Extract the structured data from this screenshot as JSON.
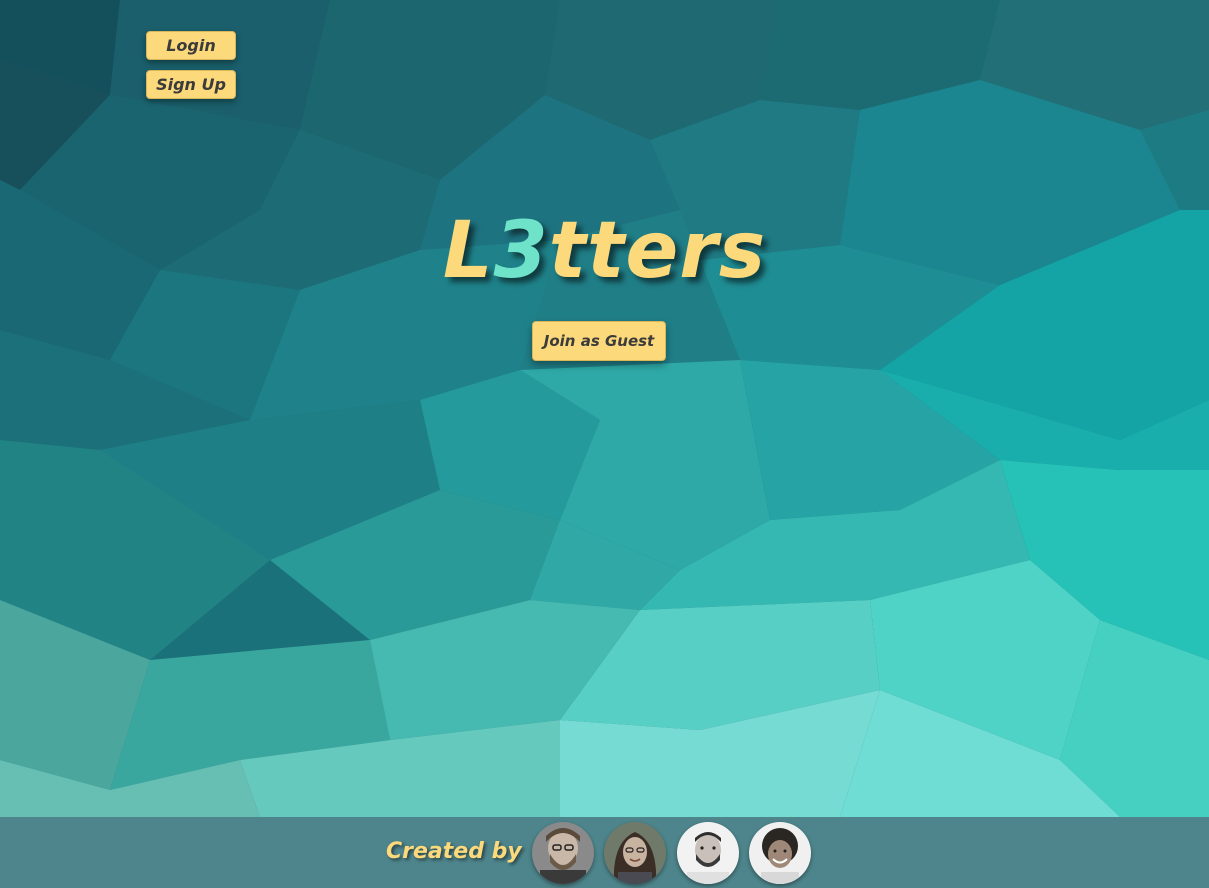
{
  "auth": {
    "login_label": "Login",
    "signup_label": "Sign Up"
  },
  "logo": {
    "part1": "L",
    "accent": "3",
    "part2": "tters"
  },
  "main": {
    "guest_label": "Join as Guest"
  },
  "footer": {
    "created_by_label": "Created by"
  },
  "colors": {
    "button_yellow": "#fcd97b",
    "logo_accent": "#6ee3c9",
    "footer_bg": "#4e858c"
  }
}
